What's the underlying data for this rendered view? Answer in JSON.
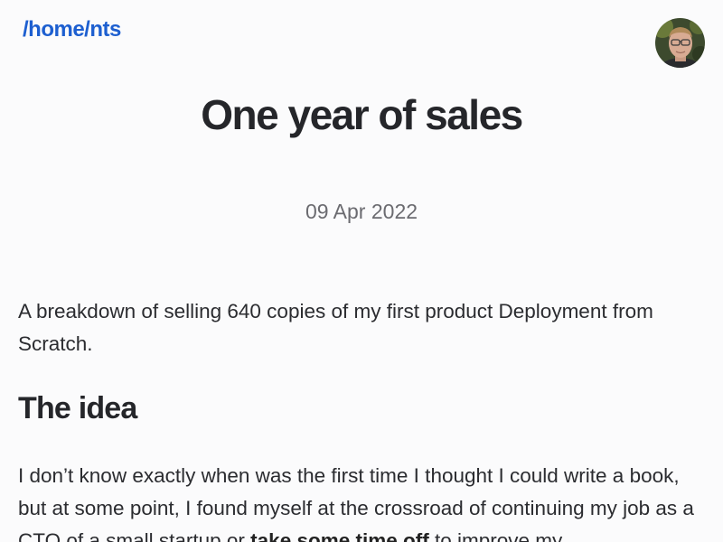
{
  "header": {
    "site_title": "/home/nts",
    "avatar_alt": "author photo"
  },
  "post": {
    "title": "One year of sales",
    "date": "09 Apr 2022",
    "intro": "A breakdown of selling 640 copies of my first product Deployment from Scratch.",
    "section_heading": "The idea",
    "body_before_bold": "I don’t know exactly when was the first time I thought I could write a book, but at some point, I found myself at the crossroad of continuing my job as a CTO of a small startup or ",
    "body_bold": "take some time off",
    "body_after_bold": " to improve my"
  },
  "colors": {
    "link": "#1d5fd0",
    "background": "#fbfbfc",
    "text": "#2b2c30",
    "date": "#6b6b70"
  }
}
